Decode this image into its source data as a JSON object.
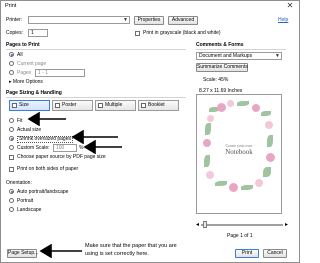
{
  "window": {
    "title": "Print",
    "close_glyph": "✕"
  },
  "printer": {
    "label": "Printer:",
    "value": "",
    "properties_button": "Properties",
    "advanced_button": "Advanced",
    "help_link": "Help"
  },
  "copies": {
    "label": "Copies:",
    "value": "1",
    "grayscale_label": "Print in grayscale (black and white)"
  },
  "pages_to_print": {
    "heading": "Pages to Print",
    "options": [
      "All",
      "Current page",
      "Pages"
    ],
    "pages_value": "1 - 1",
    "more_options": "More Options"
  },
  "sizing": {
    "heading": "Page Sizing & Handling",
    "tabs": [
      "Size",
      "Poster",
      "Multiple",
      "Booklet"
    ],
    "options": [
      "Fit",
      "Actual size",
      "Shrink oversized pages",
      "Custom Scale:"
    ],
    "custom_scale_value": "100",
    "percent": "%",
    "choose_paper_source": "Choose paper source by PDF page size"
  },
  "duplex": {
    "label": "Print on both sides of paper"
  },
  "orientation": {
    "heading": "Orientation:",
    "options": [
      "Auto portrait/landscape",
      "Portrait",
      "Landscape"
    ]
  },
  "comments": {
    "heading": "Comments & Forms",
    "value": "Document and Markups",
    "summarize_button": "Summarize Comments"
  },
  "preview": {
    "scale": "Scale: 45%",
    "dimensions": "8.27 x 11.69 Inches",
    "text_small": "Create your own",
    "text_large": "Notebook",
    "page_indicator": "Page 1 of 1"
  },
  "footer": {
    "page_setup_button": "Page Setup...",
    "note_line1": "Make sure that the paper that you are",
    "note_line2": "using is set correctly here.",
    "print_button": "Print",
    "cancel_button": "Cancel"
  },
  "colors": {
    "accent": "#2b63c2",
    "arrow": "#000000",
    "flower": "#e9a6c2",
    "leaf": "#8fb98f"
  }
}
